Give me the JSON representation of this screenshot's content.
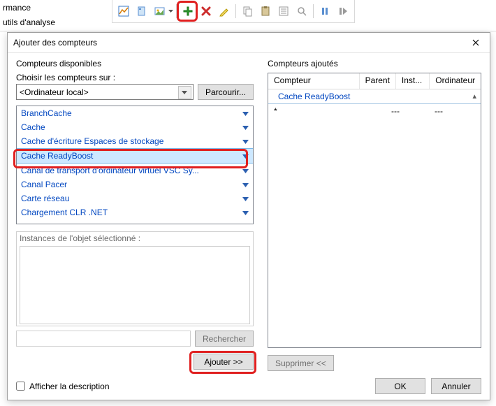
{
  "topLeft": {
    "line1": "rmance",
    "line2": "utils d'analyse"
  },
  "dialog": {
    "title": "Ajouter des compteurs",
    "left": {
      "groupLabel": "Compteurs disponibles",
      "chooseLabel": "Choisir les compteurs sur :",
      "comboValue": "<Ordinateur local>",
      "browse": "Parcourir...",
      "counters": [
        "BranchCache",
        "Cache",
        "Cache d'écriture Espaces de stockage",
        "Cache ReadyBoost",
        "Canal de transport d'ordinateur virtuel VSC Sy...",
        "Canal Pacer",
        "Carte réseau",
        "Chargement CLR .NET"
      ],
      "selectedIndex": 3,
      "instancesLabel": "Instances de l'objet sélectionné :",
      "search": "Rechercher",
      "add": "Ajouter >>"
    },
    "right": {
      "groupLabel": "Compteurs ajoutés",
      "columns": [
        "Compteur",
        "Parent",
        "Inst...",
        "Ordinateur"
      ],
      "objectRow": "Cache ReadyBoost",
      "row": {
        "compteur": "*",
        "parent": "---",
        "inst": "---",
        "ord": ""
      },
      "remove": "Supprimer <<"
    },
    "footer": {
      "showDesc": "Afficher la description",
      "ok": "OK",
      "cancel": "Annuler"
    }
  }
}
